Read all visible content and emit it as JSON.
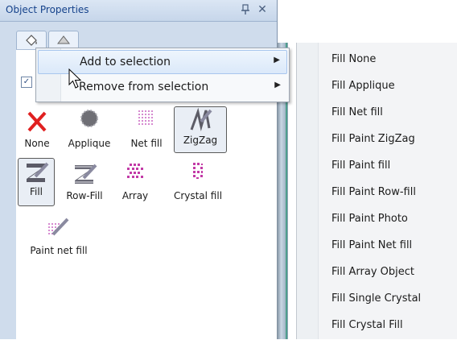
{
  "panel": {
    "title": "Object Properties",
    "pin_glyph": "p",
    "close_glyph": "✕"
  },
  "icons": {
    "pin": "pin-icon",
    "close": "close-icon",
    "cursor": "mouse-pointer-icon"
  },
  "colors": {
    "title_text": "#15428b",
    "panel_bg": "#cfdcec",
    "menu_highlight": "#dbe9f9",
    "magenta_stitch": "#c23aa6",
    "red_x": "#e02020"
  },
  "tools": [
    {
      "label": "None",
      "icon": "none-x-icon",
      "selected": false
    },
    {
      "label": "Applique",
      "icon": "applique-icon",
      "selected": false
    },
    {
      "label": "Net fill",
      "icon": "net-fill-icon",
      "selected": false
    },
    {
      "label": "ZigZag",
      "icon": "zigzag-icon",
      "selected": true
    },
    {
      "label": "Fill",
      "icon": "fill-icon",
      "selected": true
    },
    {
      "label": "Row-Fill",
      "icon": "row-fill-icon",
      "selected": false
    },
    {
      "label": "Array",
      "icon": "array-icon",
      "selected": false
    },
    {
      "label": "Crystal fill",
      "icon": "crystal-fill-icon",
      "selected": false
    },
    {
      "label": "Paint net fill",
      "icon": "paint-net-fill-icon",
      "selected": false
    }
  ],
  "checkbox": {
    "checked": true,
    "glyph": "✓"
  },
  "context_menu": {
    "items": [
      {
        "label": "Add to selection",
        "has_submenu": true,
        "highlighted": true
      },
      {
        "label": "Remove from selection",
        "has_submenu": true,
        "highlighted": false
      }
    ],
    "arrow_glyph": "▶"
  },
  "submenu": {
    "items": [
      "Fill None",
      "Fill Applique",
      "Fill Net fill",
      "Fill Paint ZigZag",
      "Fill Paint fill",
      "Fill Paint Row-fill",
      "Fill Paint Photo",
      "Fill Paint Net fill",
      "Fill Array Object",
      "Fill Single Crystal",
      "Fill Crystal Fill"
    ]
  }
}
